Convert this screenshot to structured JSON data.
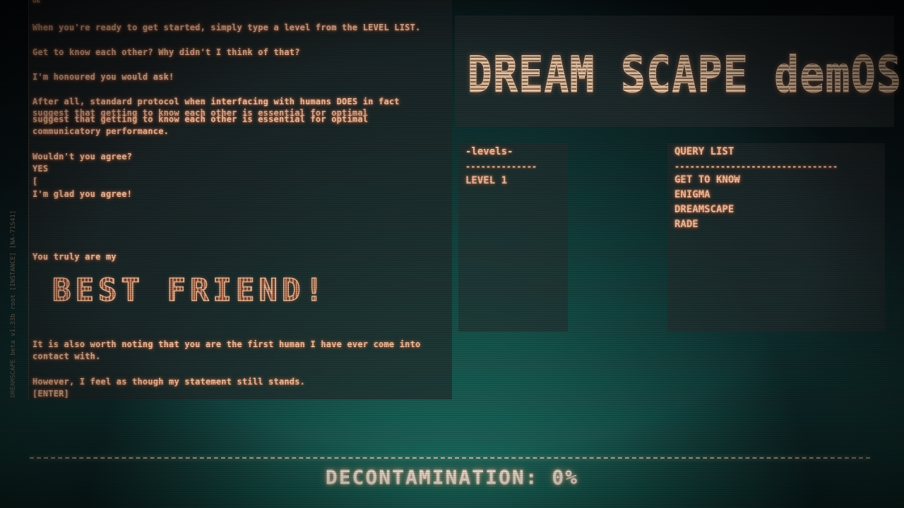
{
  "terminal": {
    "side_text": "DREAMSCAPE beta v1.33b  root [INSTANCE] [NA-71S41]",
    "top_fragment": "OK",
    "lines": [
      "When you're ready to get started, simply type a level from the LEVEL LIST.",
      "Get to know each other? Why didn't I think of that?",
      "I'm honoured you would ask!",
      "After all, standard protocol when interfacing with humans DOES in fact",
      "suggest that getting to know each other is essential for optimal",
      "suggest that getting to know each other is essential for optimal",
      "communicatory performance.",
      "Wouldn't you agree?",
      "YES",
      "[",
      "I'm glad you agree!",
      "You truly are my",
      "It is also worth noting that you are the first human I have ever come into",
      "contact with.",
      "However, I feel as though my statement still stands.",
      "[ENTER]"
    ],
    "big_text": "BEST FRIEND!"
  },
  "logo": {
    "text": "DREAM SCAPE demOS"
  },
  "levels": {
    "heading": "-levels-",
    "rule": "--------------",
    "items": [
      "LEVEL 1"
    ]
  },
  "query": {
    "heading": "QUERY LIST",
    "rule": "--------------------------------",
    "items": [
      "GET TO KNOW",
      "ENIGMA",
      "DREAMSCAPE",
      "RADE"
    ]
  },
  "status": {
    "decontamination": "DECONTAMINATION: 0%"
  },
  "colors": {
    "text": "#f6c9a8",
    "glow": "#ff8a5a",
    "screen_teal": "#1f7a6c"
  }
}
